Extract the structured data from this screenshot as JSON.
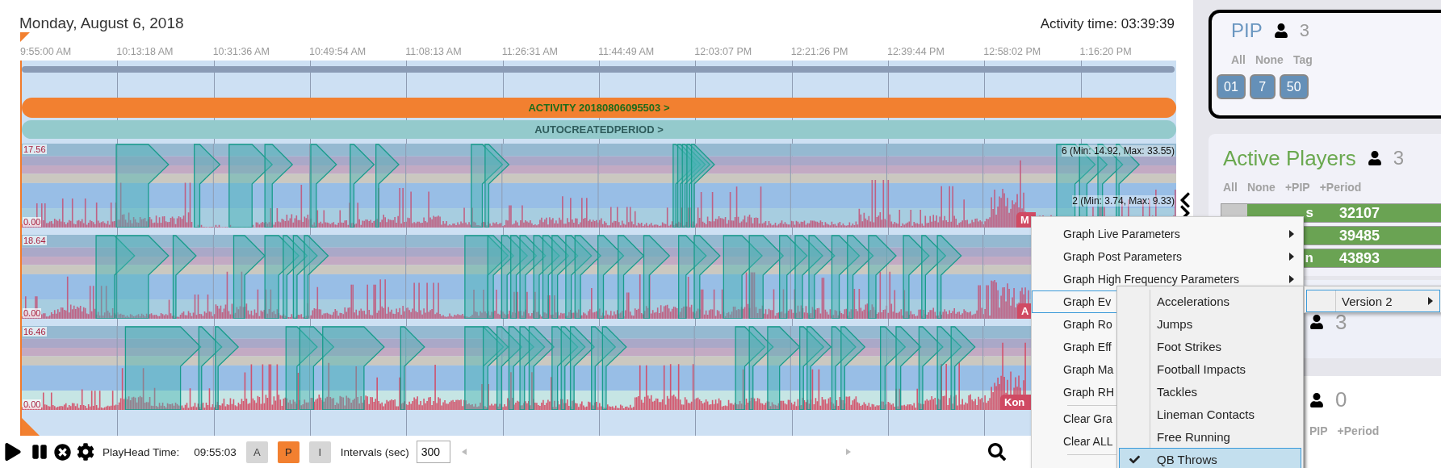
{
  "header": {
    "date": "Monday, August 6, 2018",
    "activity_time": "Activity time: 03:39:39"
  },
  "time_axis": [
    "9:55:00 AM",
    "10:13:18 AM",
    "10:31:36 AM",
    "10:49:54 AM",
    "11:08:13 AM",
    "11:26:31 AM",
    "11:44:49 AM",
    "12:03:07 PM",
    "12:21:26 PM",
    "12:39:44 PM",
    "12:58:02 PM",
    "1:16:20 PM"
  ],
  "timeline": {
    "periods": [
      {
        "kind": "activity",
        "label": "ACTIVITY 20180806095503 >"
      },
      {
        "kind": "period",
        "label": "AUTOCREATEDPERIOD >"
      }
    ],
    "graphs": [
      {
        "max": "17.56",
        "min": "0.00",
        "player": "M",
        "stats": [
          "6 (Min: 14.92, Max: 33.55)",
          "2 (Min: 3.74, Max: 9.33)"
        ]
      },
      {
        "max": "18.64",
        "min": "0.00",
        "player": "A"
      },
      {
        "max": "16.46",
        "min": "0.00",
        "player": "Kon"
      }
    ]
  },
  "toolbar": {
    "playhead_label": "PlayHead Time:",
    "playhead_time": "09:55:03",
    "modes": [
      {
        "label": "A",
        "selected": false
      },
      {
        "label": "P",
        "selected": true
      },
      {
        "label": "I",
        "selected": false
      }
    ],
    "intervals_label": "Intervals (sec)",
    "intervals_value": "300"
  },
  "context_menu": {
    "items": [
      {
        "kind": "item",
        "label": "Graph Live Parameters",
        "submenu": true,
        "selected": false
      },
      {
        "kind": "item",
        "label": "Graph Post Parameters",
        "submenu": true,
        "selected": false
      },
      {
        "kind": "item",
        "label": "Graph High Frequency Parameters",
        "submenu": true,
        "selected": false
      },
      {
        "kind": "item",
        "label": "Graph Ev",
        "selected": true
      },
      {
        "kind": "item",
        "label": "Graph Ro",
        "selected": false
      },
      {
        "kind": "item",
        "label": "Graph Eff",
        "selected": false
      },
      {
        "kind": "item",
        "label": "Graph Ma",
        "selected": false
      },
      {
        "kind": "item",
        "label": "Graph RH",
        "selected": false
      },
      {
        "kind": "separator"
      },
      {
        "kind": "item",
        "label": "Clear Gra",
        "selected": false
      },
      {
        "kind": "item",
        "label": "Clear ALL",
        "selected": false
      },
      {
        "kind": "separator"
      }
    ],
    "events_submenu": [
      {
        "label": "Accelerations",
        "checked": false,
        "selected": false
      },
      {
        "label": "Jumps",
        "checked": false,
        "selected": false
      },
      {
        "label": "Foot Strikes",
        "checked": false,
        "selected": false
      },
      {
        "label": "Football Impacts",
        "checked": false,
        "selected": false
      },
      {
        "label": "Tackles",
        "checked": false,
        "selected": false
      },
      {
        "label": "Lineman Contacts",
        "checked": false,
        "selected": false
      },
      {
        "label": "Free Running",
        "checked": false,
        "selected": false
      },
      {
        "label": "QB Throws",
        "checked": true,
        "selected": true
      }
    ],
    "version_submenu": [
      {
        "label": "Version 2",
        "submenu": true,
        "selected": true
      }
    ]
  },
  "side": {
    "pip": {
      "title": "PIP",
      "count": "3",
      "filters": [
        "All",
        "None",
        "Tag"
      ],
      "tags": [
        "01",
        "7",
        "50"
      ]
    },
    "active_players": {
      "title": "Active Players",
      "count": "3",
      "filters": [
        "All",
        "None",
        "+PIP",
        "+Period"
      ],
      "rows": [
        {
          "name": "s",
          "value": "32107"
        },
        {
          "value": "39485"
        },
        {
          "name": "n",
          "value": "43893"
        }
      ]
    },
    "groups": [
      {
        "count": "3"
      },
      {
        "count": "0",
        "filters": [
          "PIP",
          "+Period"
        ]
      }
    ]
  }
}
